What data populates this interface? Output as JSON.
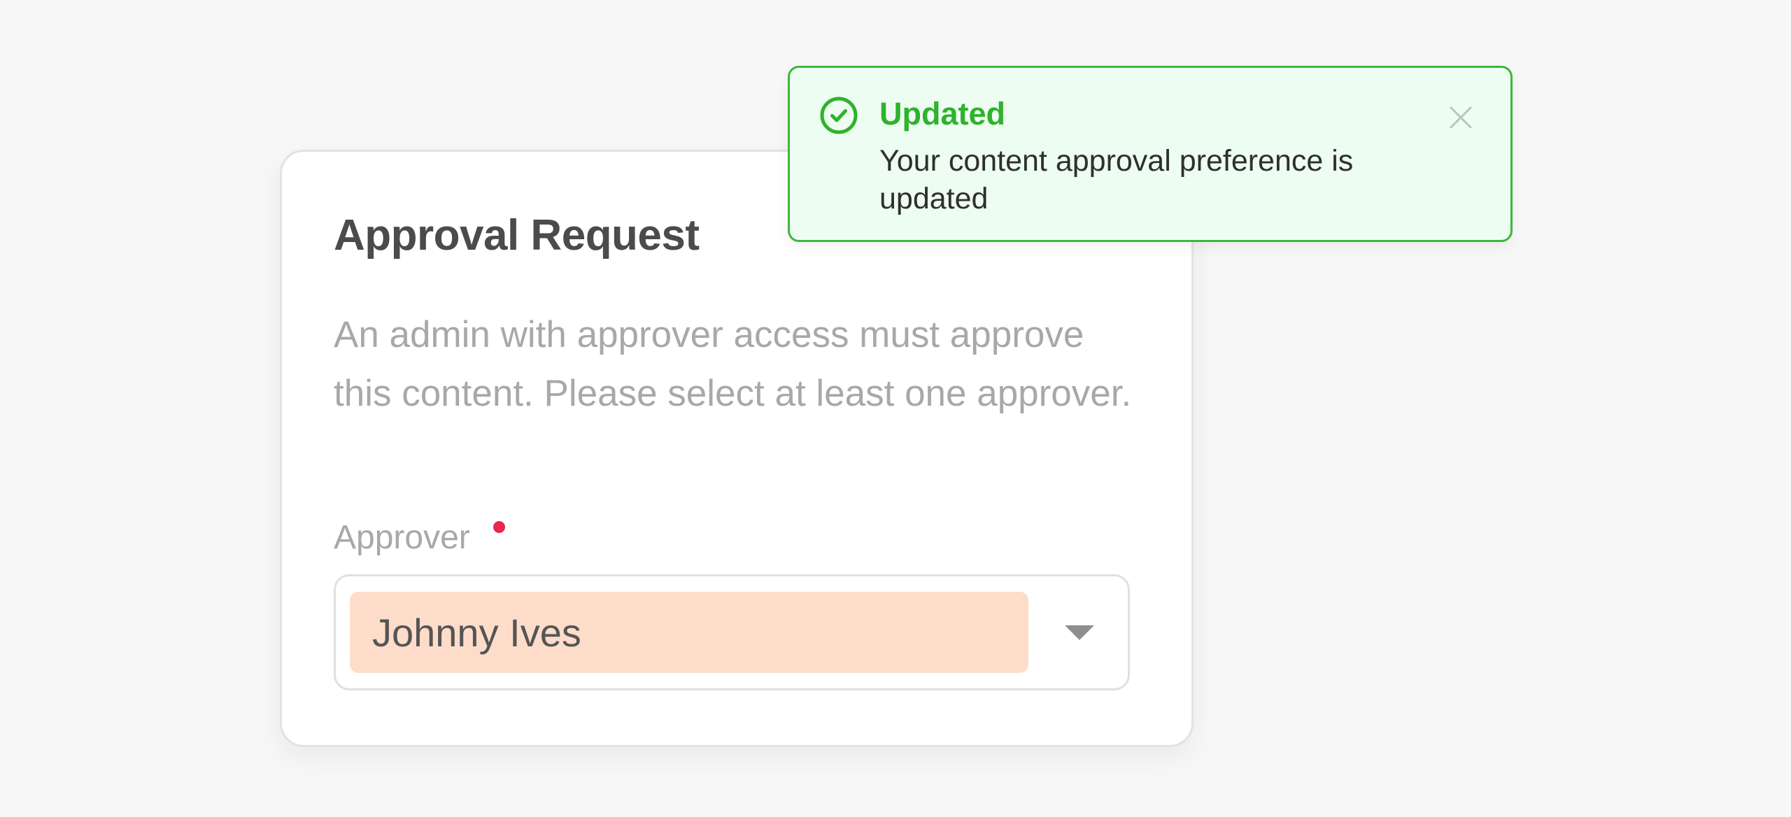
{
  "card": {
    "title": "Approval Request",
    "description": "An admin with approver access must approve this content. Please select at least one approver.",
    "field": {
      "label": "Approver",
      "required": true,
      "selected_value": "Johnny Ives"
    }
  },
  "toast": {
    "title": "Updated",
    "message": "Your content approval preference is updated",
    "status": "success",
    "icon": "check-circle-icon",
    "close_icon": "close-icon"
  },
  "colors": {
    "background": "#f7f7f7",
    "success": "#3cb83a",
    "success_bg": "#edfdf1",
    "required": "#e8284e",
    "chip_bg": "#fdddca"
  }
}
